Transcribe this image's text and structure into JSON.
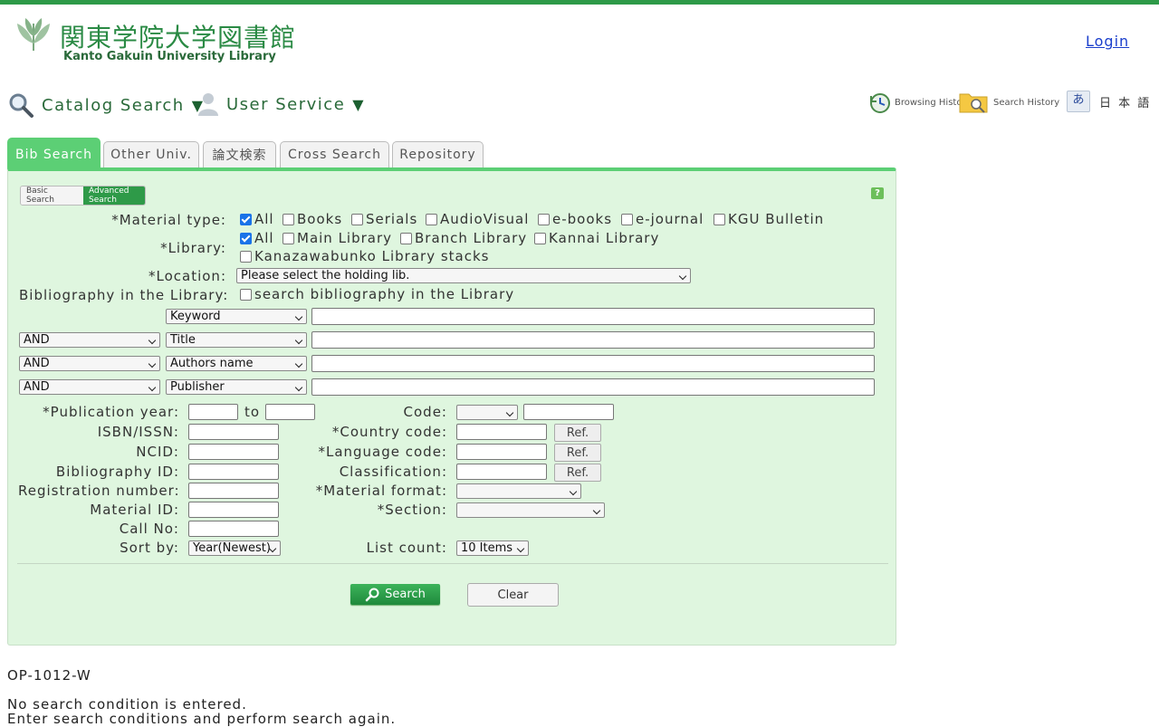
{
  "header": {
    "logo_jp": "関東学院大学図書館",
    "logo_en": "Kanto Gakuin University Library",
    "login": "Login"
  },
  "menu": {
    "catalog": "Catalog Search",
    "user_service": "User Service",
    "caret": "▼"
  },
  "util": {
    "browsing_history": "Browsing History",
    "search_history": "Search History",
    "language_glyph": "あ",
    "language": "日 本 語"
  },
  "tabs": [
    "Bib Search",
    "Other Univ.",
    "論文検索",
    "Cross Search",
    "Repository"
  ],
  "mode": {
    "basic": "Basic Search",
    "advanced": "Advanced Search",
    "help": "?"
  },
  "form": {
    "material_type_label": "*Material type:",
    "material_types": [
      {
        "label": "All",
        "checked": true
      },
      {
        "label": "Books",
        "checked": false
      },
      {
        "label": "Serials",
        "checked": false
      },
      {
        "label": "AudioVisual",
        "checked": false
      },
      {
        "label": "e-books",
        "checked": false
      },
      {
        "label": "e-journal",
        "checked": false
      },
      {
        "label": "KGU Bulletin",
        "checked": false
      }
    ],
    "library_label": "*Library:",
    "libraries": [
      {
        "label": "All",
        "checked": true
      },
      {
        "label": "Main Library",
        "checked": false
      },
      {
        "label": "Branch Library",
        "checked": false
      },
      {
        "label": "Kannai Library",
        "checked": false
      },
      {
        "label": "Kanazawabunko Library stacks",
        "checked": false
      }
    ],
    "location_label": "*Location:",
    "location_value": "Please select the holding lib.",
    "bib_in_library_label": "Bibliography in the Library:",
    "bib_in_library_option": "search bibliography in the Library",
    "rows": [
      {
        "op": "",
        "field": "Keyword",
        "value": ""
      },
      {
        "op": "AND",
        "field": "Title",
        "value": ""
      },
      {
        "op": "AND",
        "field": "Authors name",
        "value": ""
      },
      {
        "op": "AND",
        "field": "Publisher",
        "value": ""
      }
    ],
    "pub_year_label": "*Publication year:",
    "to": "to",
    "isbn_label": "ISBN/ISSN:",
    "ncid_label": "NCID:",
    "bib_id_label": "Bibliography ID:",
    "reg_no_label": "Registration number:",
    "material_id_label": "Material ID:",
    "call_no_label": "Call No:",
    "sort_label": "Sort by:",
    "sort_value": "Year(Newest)",
    "code_label": "Code:",
    "country_label": "*Country code:",
    "language_label": "*Language code:",
    "classification_label": "Classification:",
    "format_label": "*Material format:",
    "section_label": "*Section:",
    "list_count_label": "List count:",
    "list_count_value": "10 Items",
    "ref": "Ref.",
    "search": "Search",
    "clear": "Clear"
  },
  "footer": {
    "code": "OP-1012-W",
    "line1": "No search condition is entered.",
    "line2": "Enter search conditions and perform search again."
  },
  "colors": {
    "accent": "#2e9a48",
    "tab_active": "#5ccf75",
    "panel_bg": "#dff6df",
    "link": "#1a3ecc"
  }
}
